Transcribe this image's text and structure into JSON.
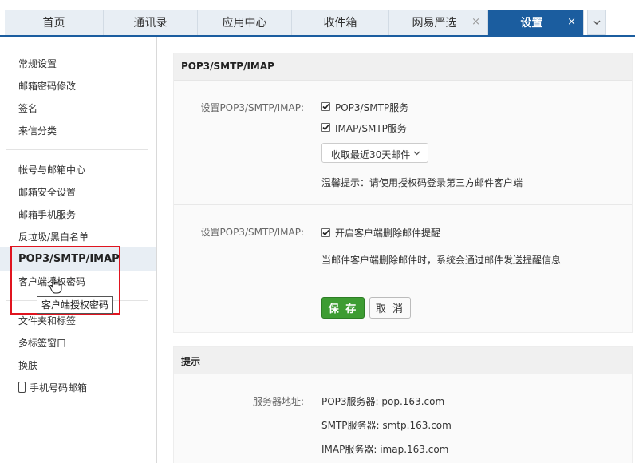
{
  "tabs": [
    {
      "label": "首页",
      "closable": false,
      "active": false
    },
    {
      "label": "通讯录",
      "closable": false,
      "active": false
    },
    {
      "label": "应用中心",
      "closable": false,
      "active": false
    },
    {
      "label": "收件箱",
      "closable": false,
      "active": false
    },
    {
      "label": "网易严选",
      "closable": true,
      "active": false
    },
    {
      "label": "设置",
      "closable": true,
      "active": true
    }
  ],
  "tab_close_glyph": "×",
  "sidebar": {
    "group1": [
      "常规设置",
      "邮箱密码修改",
      "签名",
      "来信分类"
    ],
    "group2": [
      "帐号与邮箱中心",
      "邮箱安全设置",
      "邮箱手机服务",
      "反垃圾/黑白名单",
      "POP3/SMTP/IMAP",
      "客户端授权密码"
    ],
    "group3": [
      "文件夹和标签",
      "多标签窗口",
      "换肤",
      "手机号码邮箱"
    ],
    "tooltip": "客户端授权密码"
  },
  "pop_panel": {
    "title": "POP3/SMTP/IMAP",
    "row1_label": "设置POP3/SMTP/IMAP:",
    "opt_pop3": "POP3/SMTP服务",
    "opt_imap": "IMAP/SMTP服务",
    "select_value": "收取最近30天邮件",
    "tip": "温馨提示：请使用授权码登录第三方邮件客户端",
    "row2_label": "设置POP3/SMTP/IMAP:",
    "opt_delete_notify": "开启客户端删除邮件提醒",
    "delete_desc": "当邮件客户端删除邮件时，系统会通过邮件发送提醒信息",
    "save": "保 存",
    "cancel": "取 消"
  },
  "hint_panel": {
    "title": "提示",
    "server_label": "服务器地址:",
    "pop3": "POP3服务器: pop.163.com",
    "smtp": "SMTP服务器: smtp.163.com",
    "imap": "IMAP服务器: imap.163.com"
  },
  "colors": {
    "active_tab": "#1b5d9f",
    "save_button": "#3d9c32",
    "highlight_box": "#e0141f"
  }
}
